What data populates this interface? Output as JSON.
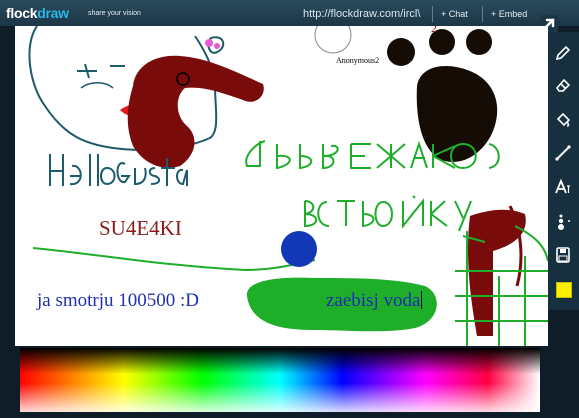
{
  "header": {
    "logo_part1": "flock",
    "logo_part2": "draw",
    "tagline": "share your vision",
    "url": "http://flockdraw.com/ircl\\",
    "chat_label": "+ Chat",
    "embed_label": "+ Embed",
    "share_icon": "share-arrow-icon"
  },
  "canvas": {
    "user_label": "Anonymous2",
    "red_text": "SU4E4KI",
    "blue_text_1": "ja smotrju 100500 :D",
    "blue_text_2": "zaebisj voda",
    "handwriting_1": "HelloGusta",
    "handwriting_2": "Я ВЪЕЖАЮ",
    "handwriting_3": "В СТРОЙКУ",
    "colors": {
      "dark_red": "#7a0b0b",
      "green": "#1fae2a",
      "blue": "#1238b8",
      "teal_line": "#1d5a6b"
    }
  },
  "toolbar": {
    "tools": [
      {
        "name": "pencil-icon"
      },
      {
        "name": "eraser-icon"
      },
      {
        "name": "fill-icon"
      },
      {
        "name": "line-icon"
      },
      {
        "name": "text-icon"
      },
      {
        "name": "brush-size-icon"
      },
      {
        "name": "save-icon"
      },
      {
        "name": "current-color-swatch",
        "color": "#ffef00"
      }
    ]
  }
}
